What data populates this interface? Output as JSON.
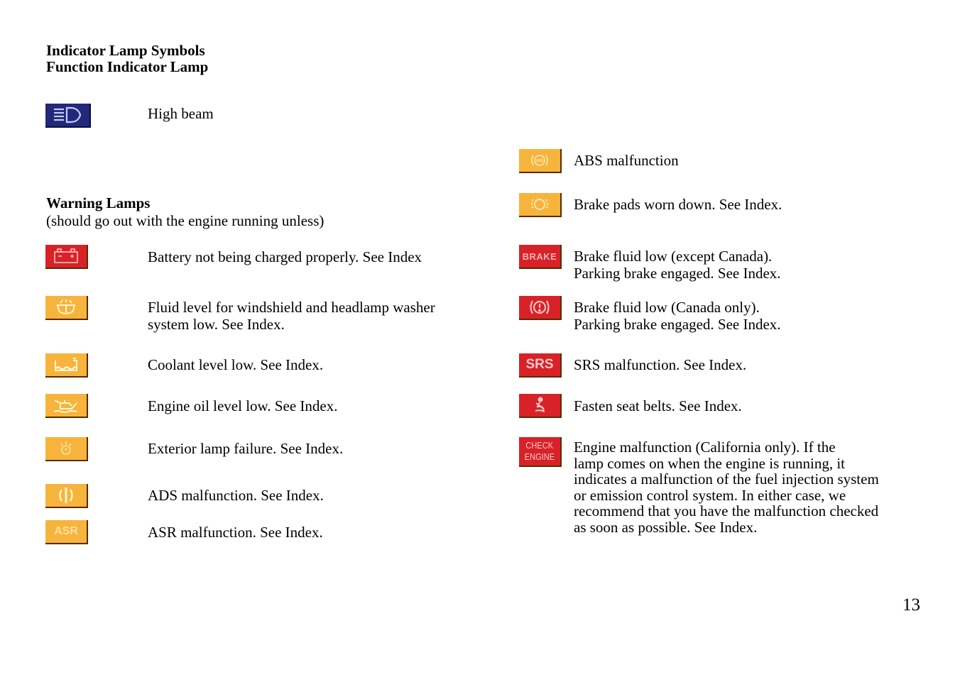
{
  "header": {
    "title_line1": "Indicator Lamp Symbols",
    "title_line2": "Function Indicator Lamp"
  },
  "function_lamps": [
    {
      "icon": "high-beam-icon",
      "color": "#22287a",
      "text": "High beam"
    }
  ],
  "warning_section": {
    "title": "Warning Lamps",
    "subtitle": "(should go out with the engine running unless)"
  },
  "left_lamps": [
    {
      "icon": "battery-icon",
      "color": "#d92128",
      "lines": [
        "Battery not being charged properly. See Index"
      ]
    },
    {
      "icon": "washer-fluid-icon",
      "color": "#f7b43c",
      "lines": [
        "Fluid level for windshield and headlamp washer",
        "system low. See Index."
      ]
    },
    {
      "icon": "coolant-level-icon",
      "color": "#f7b43c",
      "lines": [
        "Coolant level low. See Index."
      ]
    },
    {
      "icon": "oil-can-icon",
      "color": "#f7b43c",
      "lines": [
        "Engine oil level low. See Index."
      ]
    },
    {
      "icon": "exterior-lamp-icon",
      "color": "#f7b43c",
      "lines": [
        "Exterior lamp failure. See Index."
      ]
    },
    {
      "icon": "ads-icon",
      "color": "#f7b43c",
      "lines": [
        "ADS malfunction. See Index."
      ]
    },
    {
      "icon": "asr-icon",
      "color": "#f7b43c",
      "label": "ASR",
      "lines": [
        "ASR malfunction. See Index."
      ]
    }
  ],
  "right_lamps": [
    {
      "icon": "abs-icon",
      "color": "#f7b43c",
      "lines": [
        "ABS malfunction"
      ]
    },
    {
      "icon": "brake-pad-icon",
      "color": "#f7b43c",
      "lines": [
        "Brake pads worn down. See Index."
      ]
    },
    {
      "icon": "brake-text-icon",
      "color": "#d92128",
      "label": "BRAKE",
      "lines": [
        "Brake fluid low (except Canada).",
        "Parking brake engaged. See Index."
      ]
    },
    {
      "icon": "brake-symbol-icon",
      "color": "#d92128",
      "lines": [
        "Brake fluid low (Canada only).",
        "Parking brake engaged. See Index."
      ]
    },
    {
      "icon": "srs-icon",
      "color": "#d92128",
      "label": "SRS",
      "lines": [
        "SRS malfunction. See Index."
      ]
    },
    {
      "icon": "seat-belt-icon",
      "color": "#d92128",
      "lines": [
        "Fasten seat belts. See Index."
      ]
    },
    {
      "icon": "check-engine-icon",
      "color": "#d92128",
      "label_line1": "CHECK",
      "label_line2": "ENGINE",
      "lines": [
        "Engine malfunction (California only). If the",
        "lamp comes on when the engine is running, it",
        "indicates a malfunction of the fuel injection system",
        "or emission control system. In either case, we",
        "recommend that you have the malfunction checked",
        "as soon as possible. See Index."
      ]
    }
  ],
  "page_number": "13"
}
